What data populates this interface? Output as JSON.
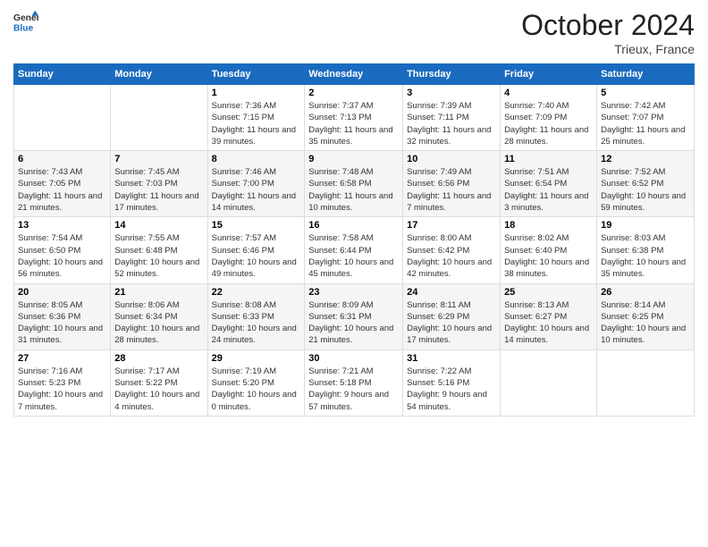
{
  "header": {
    "logo_line1": "General",
    "logo_line2": "Blue",
    "month_title": "October 2024",
    "location": "Trieux, France"
  },
  "days_of_week": [
    "Sunday",
    "Monday",
    "Tuesday",
    "Wednesday",
    "Thursday",
    "Friday",
    "Saturday"
  ],
  "weeks": [
    [
      {
        "day": "",
        "sunrise": "",
        "sunset": "",
        "daylight": ""
      },
      {
        "day": "",
        "sunrise": "",
        "sunset": "",
        "daylight": ""
      },
      {
        "day": "1",
        "sunrise": "Sunrise: 7:36 AM",
        "sunset": "Sunset: 7:15 PM",
        "daylight": "Daylight: 11 hours and 39 minutes."
      },
      {
        "day": "2",
        "sunrise": "Sunrise: 7:37 AM",
        "sunset": "Sunset: 7:13 PM",
        "daylight": "Daylight: 11 hours and 35 minutes."
      },
      {
        "day": "3",
        "sunrise": "Sunrise: 7:39 AM",
        "sunset": "Sunset: 7:11 PM",
        "daylight": "Daylight: 11 hours and 32 minutes."
      },
      {
        "day": "4",
        "sunrise": "Sunrise: 7:40 AM",
        "sunset": "Sunset: 7:09 PM",
        "daylight": "Daylight: 11 hours and 28 minutes."
      },
      {
        "day": "5",
        "sunrise": "Sunrise: 7:42 AM",
        "sunset": "Sunset: 7:07 PM",
        "daylight": "Daylight: 11 hours and 25 minutes."
      }
    ],
    [
      {
        "day": "6",
        "sunrise": "Sunrise: 7:43 AM",
        "sunset": "Sunset: 7:05 PM",
        "daylight": "Daylight: 11 hours and 21 minutes."
      },
      {
        "day": "7",
        "sunrise": "Sunrise: 7:45 AM",
        "sunset": "Sunset: 7:03 PM",
        "daylight": "Daylight: 11 hours and 17 minutes."
      },
      {
        "day": "8",
        "sunrise": "Sunrise: 7:46 AM",
        "sunset": "Sunset: 7:00 PM",
        "daylight": "Daylight: 11 hours and 14 minutes."
      },
      {
        "day": "9",
        "sunrise": "Sunrise: 7:48 AM",
        "sunset": "Sunset: 6:58 PM",
        "daylight": "Daylight: 11 hours and 10 minutes."
      },
      {
        "day": "10",
        "sunrise": "Sunrise: 7:49 AM",
        "sunset": "Sunset: 6:56 PM",
        "daylight": "Daylight: 11 hours and 7 minutes."
      },
      {
        "day": "11",
        "sunrise": "Sunrise: 7:51 AM",
        "sunset": "Sunset: 6:54 PM",
        "daylight": "Daylight: 11 hours and 3 minutes."
      },
      {
        "day": "12",
        "sunrise": "Sunrise: 7:52 AM",
        "sunset": "Sunset: 6:52 PM",
        "daylight": "Daylight: 10 hours and 59 minutes."
      }
    ],
    [
      {
        "day": "13",
        "sunrise": "Sunrise: 7:54 AM",
        "sunset": "Sunset: 6:50 PM",
        "daylight": "Daylight: 10 hours and 56 minutes."
      },
      {
        "day": "14",
        "sunrise": "Sunrise: 7:55 AM",
        "sunset": "Sunset: 6:48 PM",
        "daylight": "Daylight: 10 hours and 52 minutes."
      },
      {
        "day": "15",
        "sunrise": "Sunrise: 7:57 AM",
        "sunset": "Sunset: 6:46 PM",
        "daylight": "Daylight: 10 hours and 49 minutes."
      },
      {
        "day": "16",
        "sunrise": "Sunrise: 7:58 AM",
        "sunset": "Sunset: 6:44 PM",
        "daylight": "Daylight: 10 hours and 45 minutes."
      },
      {
        "day": "17",
        "sunrise": "Sunrise: 8:00 AM",
        "sunset": "Sunset: 6:42 PM",
        "daylight": "Daylight: 10 hours and 42 minutes."
      },
      {
        "day": "18",
        "sunrise": "Sunrise: 8:02 AM",
        "sunset": "Sunset: 6:40 PM",
        "daylight": "Daylight: 10 hours and 38 minutes."
      },
      {
        "day": "19",
        "sunrise": "Sunrise: 8:03 AM",
        "sunset": "Sunset: 6:38 PM",
        "daylight": "Daylight: 10 hours and 35 minutes."
      }
    ],
    [
      {
        "day": "20",
        "sunrise": "Sunrise: 8:05 AM",
        "sunset": "Sunset: 6:36 PM",
        "daylight": "Daylight: 10 hours and 31 minutes."
      },
      {
        "day": "21",
        "sunrise": "Sunrise: 8:06 AM",
        "sunset": "Sunset: 6:34 PM",
        "daylight": "Daylight: 10 hours and 28 minutes."
      },
      {
        "day": "22",
        "sunrise": "Sunrise: 8:08 AM",
        "sunset": "Sunset: 6:33 PM",
        "daylight": "Daylight: 10 hours and 24 minutes."
      },
      {
        "day": "23",
        "sunrise": "Sunrise: 8:09 AM",
        "sunset": "Sunset: 6:31 PM",
        "daylight": "Daylight: 10 hours and 21 minutes."
      },
      {
        "day": "24",
        "sunrise": "Sunrise: 8:11 AM",
        "sunset": "Sunset: 6:29 PM",
        "daylight": "Daylight: 10 hours and 17 minutes."
      },
      {
        "day": "25",
        "sunrise": "Sunrise: 8:13 AM",
        "sunset": "Sunset: 6:27 PM",
        "daylight": "Daylight: 10 hours and 14 minutes."
      },
      {
        "day": "26",
        "sunrise": "Sunrise: 8:14 AM",
        "sunset": "Sunset: 6:25 PM",
        "daylight": "Daylight: 10 hours and 10 minutes."
      }
    ],
    [
      {
        "day": "27",
        "sunrise": "Sunrise: 7:16 AM",
        "sunset": "Sunset: 5:23 PM",
        "daylight": "Daylight: 10 hours and 7 minutes."
      },
      {
        "day": "28",
        "sunrise": "Sunrise: 7:17 AM",
        "sunset": "Sunset: 5:22 PM",
        "daylight": "Daylight: 10 hours and 4 minutes."
      },
      {
        "day": "29",
        "sunrise": "Sunrise: 7:19 AM",
        "sunset": "Sunset: 5:20 PM",
        "daylight": "Daylight: 10 hours and 0 minutes."
      },
      {
        "day": "30",
        "sunrise": "Sunrise: 7:21 AM",
        "sunset": "Sunset: 5:18 PM",
        "daylight": "Daylight: 9 hours and 57 minutes."
      },
      {
        "day": "31",
        "sunrise": "Sunrise: 7:22 AM",
        "sunset": "Sunset: 5:16 PM",
        "daylight": "Daylight: 9 hours and 54 minutes."
      },
      {
        "day": "",
        "sunrise": "",
        "sunset": "",
        "daylight": ""
      },
      {
        "day": "",
        "sunrise": "",
        "sunset": "",
        "daylight": ""
      }
    ]
  ]
}
